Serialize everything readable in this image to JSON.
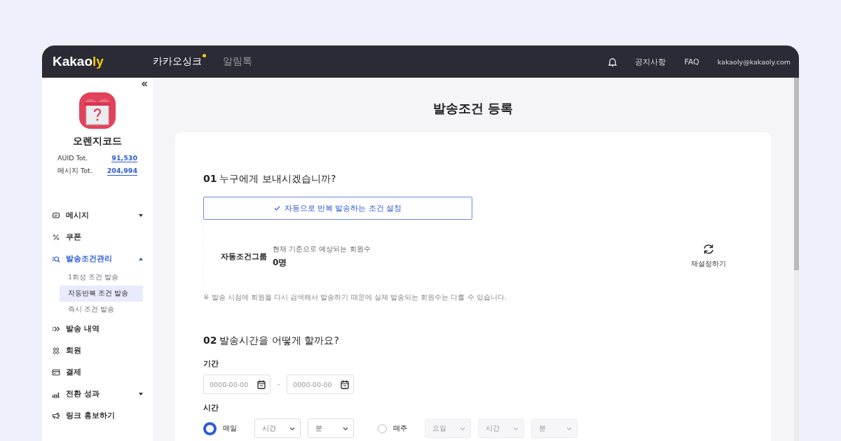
{
  "header": {
    "logo": {
      "text": "Kakao",
      "accent": "ly"
    },
    "nav": [
      {
        "label": "카카오싱크",
        "selected": true,
        "new": true
      },
      {
        "label": "알림톡",
        "selected": false,
        "new": false
      }
    ],
    "links": [
      "공지사항",
      "FAQ"
    ],
    "account": "kakaoly@kakaoly.com"
  },
  "sidebar": {
    "profile": {
      "name": "오렌지코드",
      "stats": [
        {
          "label": "AUID Tot.",
          "value": "91,530"
        },
        {
          "label": "메시지 Tot.",
          "value": "204,994"
        }
      ]
    },
    "items": [
      {
        "label": "메시지",
        "selected": false,
        "expanded": false
      },
      {
        "label": "쿠폰",
        "selected": false
      },
      {
        "label": "발송조건관리",
        "selected": true,
        "expanded": true,
        "children": [
          {
            "label": "1회성 조건 발송",
            "selected": false
          },
          {
            "label": "자동반복 조건 발송",
            "selected": true
          },
          {
            "label": "즉시 조건 발송",
            "selected": false
          }
        ]
      },
      {
        "label": "발송 내역",
        "selected": false
      },
      {
        "label": "회원",
        "selected": false
      },
      {
        "label": "결제",
        "selected": false
      },
      {
        "label": "전환 성과",
        "selected": false,
        "expanded": false
      },
      {
        "label": "링크 홍보하기",
        "selected": false
      }
    ]
  },
  "page": {
    "title": "발송조건 등록",
    "section1": {
      "number": "01",
      "title": "누구에게 보내시겠습니까?",
      "option": {
        "label": "자동으로 반복 발송하는 조건 설정",
        "selected": true
      },
      "group": {
        "label": "자동조건그룹",
        "caption": "현재 기준으로 예상되는 회원수",
        "count": "0명",
        "reset": "재설정하기"
      },
      "note": "※ 발송 시점에 회원을 다시 검색해서 발송하기 때문에 실제 발송되는 회원수는 다를 수 있습니다."
    },
    "section2": {
      "number": "02",
      "title": "발송시간을 어떻게 할까요?",
      "period_label": "기간",
      "dates": [
        {
          "placeholder": "0000-00-00"
        },
        {
          "placeholder": "0000-00-00"
        }
      ],
      "date_separator": "-",
      "time_label": "시간",
      "schedules": [
        {
          "label": "매일",
          "selected": true,
          "selects": [
            {
              "placeholder": "시간",
              "disabled": false
            },
            {
              "placeholder": "분",
              "disabled": false
            }
          ]
        },
        {
          "label": "매주",
          "selected": false,
          "selects": [
            {
              "placeholder": "요일",
              "disabled": true
            },
            {
              "placeholder": "시간",
              "disabled": true
            },
            {
              "placeholder": "분",
              "disabled": true
            }
          ]
        }
      ]
    }
  }
}
